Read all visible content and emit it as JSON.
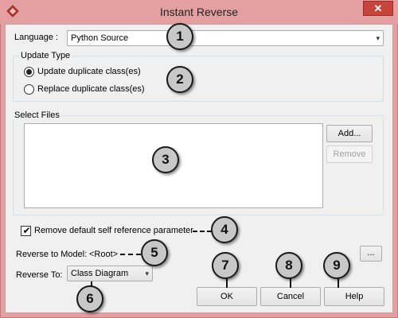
{
  "window": {
    "title": "Instant Reverse",
    "close_glyph": "✕"
  },
  "language": {
    "label": "Language :",
    "value": "Python Source"
  },
  "update_type": {
    "legend": "Update Type",
    "options": [
      {
        "label": "Update duplicate class(es)",
        "selected": true
      },
      {
        "label": "Replace duplicate class(es)",
        "selected": false
      }
    ]
  },
  "select_files": {
    "legend": "Select Files",
    "add_label": "Add...",
    "remove_label": "Remove"
  },
  "remove_self_ref": {
    "label": "Remove default self reference parameter",
    "checked": true
  },
  "reverse_to_model": {
    "label": "Reverse to Model:",
    "value": "<Root>",
    "browse_label": "..."
  },
  "reverse_to": {
    "label": "Reverse To:",
    "value": "Class Diagram"
  },
  "buttons": {
    "ok": "OK",
    "cancel": "Cancel",
    "help": "Help"
  },
  "callouts": [
    "1",
    "2",
    "3",
    "4",
    "5",
    "6",
    "7",
    "8",
    "9"
  ],
  "icons": {
    "app": "red-diamond-icon",
    "dropdown": "▾",
    "check": "✔"
  }
}
